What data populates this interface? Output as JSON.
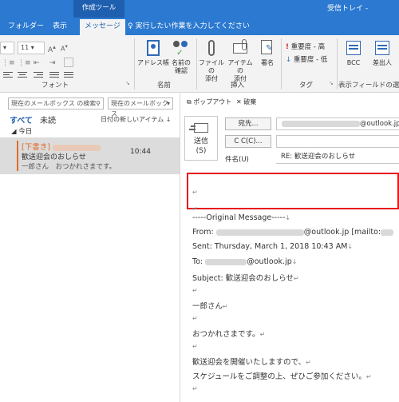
{
  "titlebar": {
    "contextual_tab": "作成ツール",
    "window_title": "受信トレイ -"
  },
  "tabs": [
    {
      "label": "フォルダー"
    },
    {
      "label": "表示"
    },
    {
      "label": "メッセージ"
    }
  ],
  "tell_me": "実行したい作業を入力してください",
  "ribbon": {
    "font_size": "11",
    "groups": {
      "font": "フォント",
      "names": "名前",
      "insert": "挿入",
      "tags": "タグ",
      "show_fields": "表示フィールドの選択"
    },
    "buttons": {
      "address_book": "アドレス帳",
      "check_names_1": "名前の",
      "check_names_2": "確認",
      "attach_file_1": "ファイルの",
      "attach_file_2": "添付",
      "attach_item_1": "アイテムの",
      "attach_item_2": "添付",
      "signature": "署名",
      "high_importance": "重要度 - 高",
      "low_importance": "重要度 - 低",
      "bcc": "BCC",
      "from": "差出人"
    }
  },
  "left": {
    "search_placeholder": "現在のメールボックス の検索",
    "scope": "現在のメールボックス",
    "filter_all": "すべて",
    "filter_unread": "未読",
    "sort": "日付の新しいアイテム",
    "group": "今日",
    "message": {
      "draft": "[下書き]",
      "subject": "歓送迎会のおしらせ",
      "preview": "一郎さん　おつかれさまです。",
      "time": "10:44"
    }
  },
  "compose": {
    "popout": "ポップアウト",
    "discard": "破棄",
    "send_1": "送信",
    "send_2": "(S)",
    "to_button": "宛先...",
    "cc_button": "C C(C)...",
    "to_domain": "@outlook.jp",
    "subject_label": "件名(U)",
    "subject_value": "RE: 歓送迎会のおしらせ",
    "body": {
      "original": "-----Original Message-----",
      "from_label": "From:",
      "from_domain": "@outlook.jp [mailto:",
      "sent": "Sent: Thursday, March 1, 2018 10:43 AM",
      "to_label": "To:",
      "to_domain": "@outlook.jp",
      "subject": "Subject: 歓送迎会のおしらせ",
      "line1": "一郎さん",
      "line2": "おつかれさまです。",
      "line3": "歓送迎会を開催いたしますので、",
      "line4": "スケジュールをご調整の上、ぜひご参加ください。"
    }
  },
  "colors": {
    "accent": "#2b79d0",
    "draft": "#e06c2b",
    "highlight": "#e8141b"
  }
}
